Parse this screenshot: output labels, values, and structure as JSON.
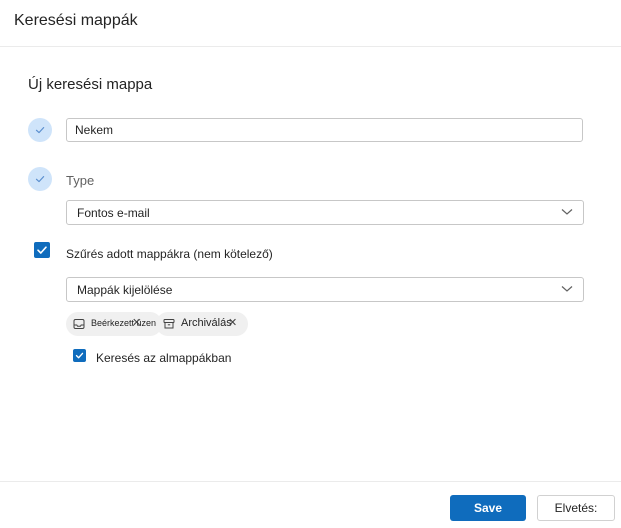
{
  "header": {
    "title": "Keresési mappák"
  },
  "form": {
    "section_title": "Új keresési mappa",
    "name_input_value": "Nekem",
    "type_label": "Type",
    "type_selected": "Fontos e-mail",
    "filter_label": "Szűrés adott mappákra (nem kötelező)",
    "filter_checked": true,
    "folder_select_placeholder": "Mappák kijelölése",
    "chips": [
      {
        "label": "Beérkezett üzenetek",
        "icon": "inbox-icon"
      },
      {
        "label": "Archiválás",
        "icon": "archive-icon"
      }
    ],
    "subfolders_label": "Keresés az almappákban",
    "subfolders_checked": true
  },
  "footer": {
    "save_label": "Save",
    "discard_label": "Elvetés:"
  },
  "colors": {
    "accent": "#0f6cbd",
    "step_circle": "#cfe4fa",
    "chip_bg": "#f0f0f0"
  }
}
